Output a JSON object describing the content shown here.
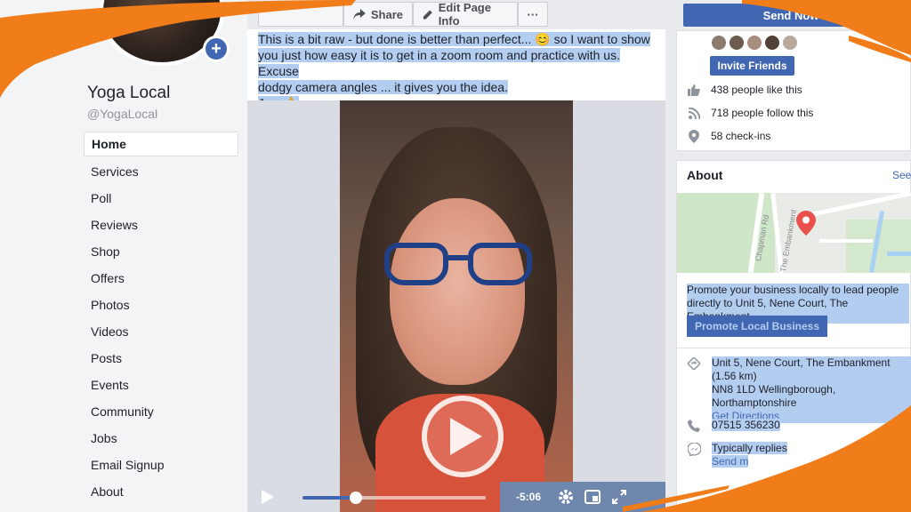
{
  "page": {
    "name": "Yoga Local",
    "handle": "@YogaLocal"
  },
  "nav": {
    "items": [
      "Home",
      "Services",
      "Poll",
      "Reviews",
      "Shop",
      "Offers",
      "Photos",
      "Videos",
      "Posts",
      "Events",
      "Community",
      "Jobs",
      "Email Signup",
      "About"
    ],
    "active": "Home"
  },
  "toolbar": {
    "share_label": "Share",
    "edit_label": "Edit Page Info",
    "more_label": "···"
  },
  "post": {
    "lines": [
      "This is a bit raw - but done is better than perfect... 😊 so I want to show",
      "you just how easy it is to get in a zoom room and practice with us. Excuse",
      "dodgy camera angles ... it gives you the idea.",
      "J xx 🙏"
    ]
  },
  "video": {
    "time_remaining": "-5:06",
    "progress": 0.29
  },
  "sidebar": {
    "send_label": "Send Now",
    "invite_label": "Invite Friends",
    "likes": "438 people like this",
    "follows": "718 people follow this",
    "checkins": "58 check-ins"
  },
  "about": {
    "title": "About",
    "see_all": "See",
    "map_labels": [
      "Chapman Rd",
      "The Embankment"
    ],
    "promote_text": "Promote your business locally to lead people directly to Unit 5, Nene Court, The Embankment",
    "promote_button": "Promote Local Business",
    "address_line1": "Unit 5, Nene Court, The Embankment (1.56 km)",
    "address_line2": "NN8 1LD Wellingborough, Northamptonshire",
    "directions": "Get Directions",
    "phone": "07515 356230",
    "replies": "Typically replies",
    "send_message": "Send m"
  },
  "colors": {
    "brand": "#4267b2",
    "highlight": "#b3cdf0",
    "accent_orange": "#f07d1a"
  }
}
